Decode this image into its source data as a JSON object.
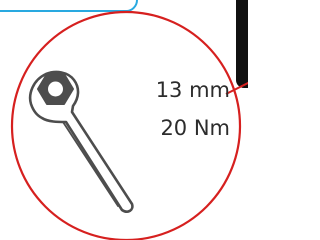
{
  "detail": {
    "wrench_size": "13 mm",
    "torque": "20 Nm"
  },
  "colors": {
    "circle_border": "#d6201f",
    "callout_border": "#29a9e0",
    "icon_stroke": "#4d4d4d",
    "text": "#2c2c2c",
    "panel": "#111111"
  },
  "icons": {
    "tool": "wrench-icon",
    "fastener": "hex-nut-icon"
  }
}
